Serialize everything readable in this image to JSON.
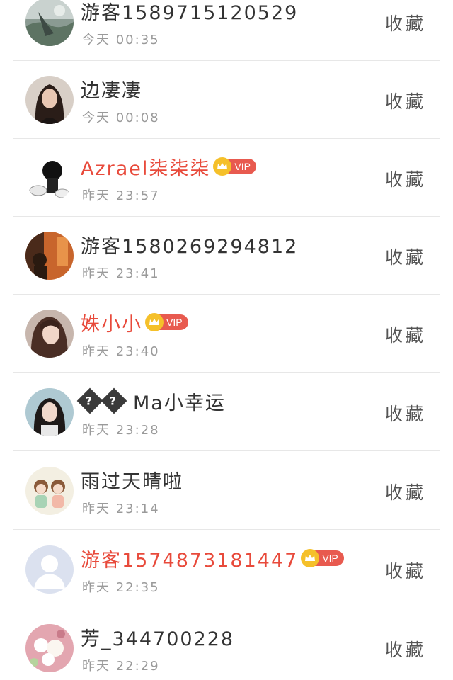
{
  "list": {
    "items": [
      {
        "name": "游客1589715120529",
        "time": "今天 00:35",
        "vip": false,
        "action": "收藏",
        "avatar_icon": "landscape-avatar-icon"
      },
      {
        "name": "边凄凄",
        "time": "今天 00:08",
        "vip": false,
        "action": "收藏",
        "avatar_icon": "woman-dark-hair-avatar-icon"
      },
      {
        "name": "Azrael柒柒柒",
        "time": "昨天 23:57",
        "vip": true,
        "vip_label": "VIP",
        "action": "收藏",
        "avatar_icon": "cartoon-character-avatar-icon"
      },
      {
        "name": "游客1580269294812",
        "time": "昨天 23:41",
        "vip": false,
        "action": "收藏",
        "avatar_icon": "orange-silhouette-avatar-icon"
      },
      {
        "name": "姝小小",
        "time": "昨天 23:40",
        "vip": true,
        "vip_label": "VIP",
        "action": "收藏",
        "avatar_icon": "woman-portrait-avatar-icon"
      },
      {
        "name": "Ma小幸运",
        "time": "昨天 23:28",
        "vip": false,
        "action": "收藏",
        "avatar_icon": "girl-portrait-avatar-icon"
      },
      {
        "name": "雨过天晴啦",
        "time": "昨天 23:14",
        "vip": false,
        "action": "收藏",
        "avatar_icon": "cartoon-girls-avatar-icon"
      },
      {
        "name": "游客1574873181447",
        "time": "昨天 22:35",
        "vip": true,
        "vip_label": "VIP",
        "action": "收藏",
        "avatar_icon": "default-user-avatar-icon"
      },
      {
        "name": "芳_344700228",
        "time": "昨天 22:29",
        "vip": false,
        "action": "收藏",
        "avatar_icon": "flowers-avatar-icon"
      }
    ]
  },
  "colors": {
    "vip_name": "#e84a3b",
    "normal_name": "#333333",
    "time": "#9a9a9a",
    "vip_badge": "#e85a4f",
    "crown": "#f5c02a"
  }
}
